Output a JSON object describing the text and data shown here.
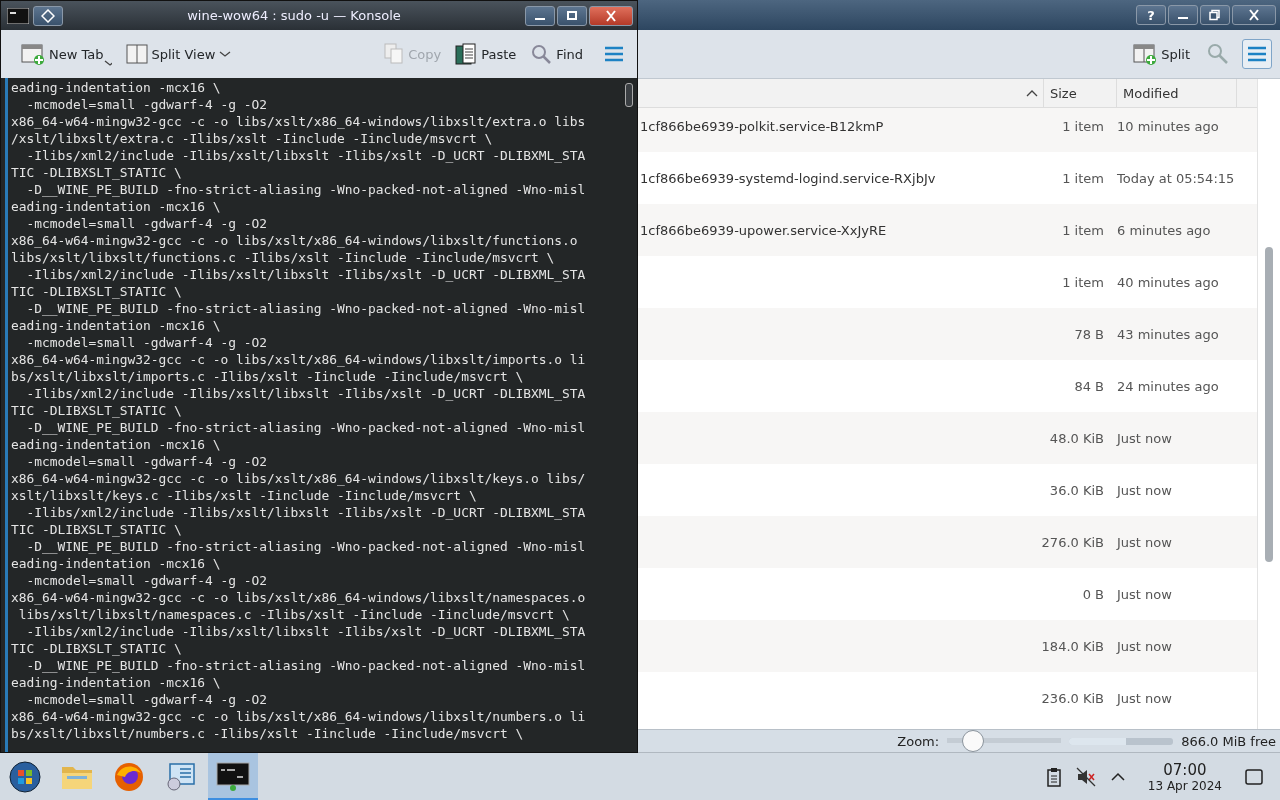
{
  "terminal": {
    "title": "wine-wow64 : sudo -u — Konsole",
    "toolbar": [
      {
        "kind": "newtab",
        "label": "New Tab",
        "disabled": false,
        "dropdown": true
      },
      {
        "kind": "split",
        "label": "Split View",
        "disabled": false,
        "dropdown": true
      },
      {
        "kind": "copy",
        "label": "Copy",
        "disabled": true,
        "dropdown": false
      },
      {
        "kind": "paste",
        "label": "Paste",
        "disabled": false,
        "dropdown": false
      },
      {
        "kind": "find",
        "label": "Find",
        "disabled": false,
        "dropdown": false
      }
    ],
    "lines": [
      "eading-indentation -mcx16 \\",
      "  -mcmodel=small -gdwarf-4 -g -O2",
      "x86_64-w64-mingw32-gcc -c -o libs/xslt/x86_64-windows/libxslt/extra.o libs",
      "/xslt/libxslt/extra.c -Ilibs/xslt -Iinclude -Iinclude/msvcrt \\",
      "  -Ilibs/xml2/include -Ilibs/xslt/libxslt -Ilibs/xslt -D_UCRT -DLIBXML_STA",
      "TIC -DLIBXSLT_STATIC \\",
      "  -D__WINE_PE_BUILD -fno-strict-aliasing -Wno-packed-not-aligned -Wno-misl",
      "eading-indentation -mcx16 \\",
      "  -mcmodel=small -gdwarf-4 -g -O2",
      "x86_64-w64-mingw32-gcc -c -o libs/xslt/x86_64-windows/libxslt/functions.o",
      "libs/xslt/libxslt/functions.c -Ilibs/xslt -Iinclude -Iinclude/msvcrt \\",
      "  -Ilibs/xml2/include -Ilibs/xslt/libxslt -Ilibs/xslt -D_UCRT -DLIBXML_STA",
      "TIC -DLIBXSLT_STATIC \\",
      "  -D__WINE_PE_BUILD -fno-strict-aliasing -Wno-packed-not-aligned -Wno-misl",
      "eading-indentation -mcx16 \\",
      "  -mcmodel=small -gdwarf-4 -g -O2",
      "x86_64-w64-mingw32-gcc -c -o libs/xslt/x86_64-windows/libxslt/imports.o li",
      "bs/xslt/libxslt/imports.c -Ilibs/xslt -Iinclude -Iinclude/msvcrt \\",
      "  -Ilibs/xml2/include -Ilibs/xslt/libxslt -Ilibs/xslt -D_UCRT -DLIBXML_STA",
      "TIC -DLIBXSLT_STATIC \\",
      "  -D__WINE_PE_BUILD -fno-strict-aliasing -Wno-packed-not-aligned -Wno-misl",
      "eading-indentation -mcx16 \\",
      "  -mcmodel=small -gdwarf-4 -g -O2",
      "x86_64-w64-mingw32-gcc -c -o libs/xslt/x86_64-windows/libxslt/keys.o libs/",
      "xslt/libxslt/keys.c -Ilibs/xslt -Iinclude -Iinclude/msvcrt \\",
      "  -Ilibs/xml2/include -Ilibs/xslt/libxslt -Ilibs/xslt -D_UCRT -DLIBXML_STA",
      "TIC -DLIBXSLT_STATIC \\",
      "  -D__WINE_PE_BUILD -fno-strict-aliasing -Wno-packed-not-aligned -Wno-misl",
      "eading-indentation -mcx16 \\",
      "  -mcmodel=small -gdwarf-4 -g -O2",
      "x86_64-w64-mingw32-gcc -c -o libs/xslt/x86_64-windows/libxslt/namespaces.o",
      " libs/xslt/libxslt/namespaces.c -Ilibs/xslt -Iinclude -Iinclude/msvcrt \\",
      "  -Ilibs/xml2/include -Ilibs/xslt/libxslt -Ilibs/xslt -D_UCRT -DLIBXML_STA",
      "TIC -DLIBXSLT_STATIC \\",
      "  -D__WINE_PE_BUILD -fno-strict-aliasing -Wno-packed-not-aligned -Wno-misl",
      "eading-indentation -mcx16 \\",
      "  -mcmodel=small -gdwarf-4 -g -O2",
      "x86_64-w64-mingw32-gcc -c -o libs/xslt/x86_64-windows/libxslt/numbers.o li",
      "bs/xslt/libxslt/numbers.c -Ilibs/xslt -Iinclude -Iinclude/msvcrt \\"
    ]
  },
  "file_manager": {
    "help_label": "?",
    "split_label": "Split",
    "columns": [
      {
        "label": "Size"
      },
      {
        "label": "Modified"
      }
    ],
    "rows": [
      {
        "name": "1cf866be6939-polkit.service-B12kmP",
        "size": "1 item",
        "modified": "10 minutes ago"
      },
      {
        "name": "1cf866be6939-systemd-logind.service-RXjbJv",
        "size": "1 item",
        "modified": "Today at 05:54:15"
      },
      {
        "name": "1cf866be6939-upower.service-XxJyRE",
        "size": "1 item",
        "modified": "6 minutes ago"
      },
      {
        "size": "1 item",
        "modified": "40 minutes ago"
      },
      {
        "size": "78 B",
        "modified": "43 minutes ago"
      },
      {
        "size": "84 B",
        "modified": "24 minutes ago"
      },
      {
        "size": "48.0 KiB",
        "modified": "Just now"
      },
      {
        "size": "36.0 KiB",
        "modified": "Just now"
      },
      {
        "size": "276.0 KiB",
        "modified": "Just now"
      },
      {
        "size": "0 B",
        "modified": "Just now"
      },
      {
        "size": "184.0 KiB",
        "modified": "Just now"
      },
      {
        "size": "236.0 KiB",
        "modified": "Just now"
      }
    ],
    "status_bar": {
      "zoom_label": "Zoom:",
      "zoom": {
        "level": 0.16
      },
      "space": {
        "level": 0.55
      },
      "free_space": "866.0 MiB free"
    }
  },
  "taskbar": {
    "apps": [
      {
        "kind": "start",
        "selected": false
      },
      {
        "kind": "folder",
        "selected": false
      },
      {
        "kind": "browser",
        "selected": false
      },
      {
        "kind": "settings",
        "selected": false
      },
      {
        "kind": "terminal",
        "selected": true
      }
    ],
    "clock": {
      "time": "07:00",
      "date": "13 Apr 2024"
    }
  }
}
